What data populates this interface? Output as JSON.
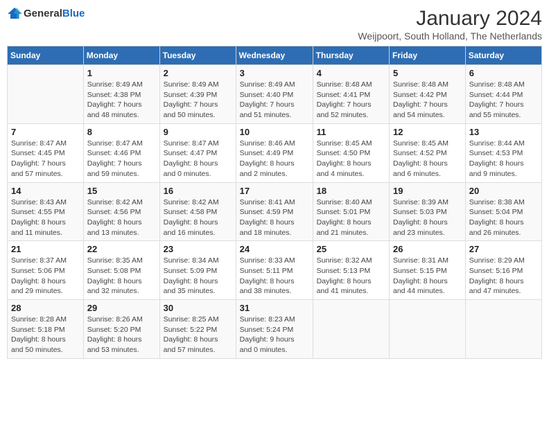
{
  "logo": {
    "text_general": "General",
    "text_blue": "Blue"
  },
  "header": {
    "month_title": "January 2024",
    "subtitle": "Weijpoort, South Holland, The Netherlands"
  },
  "days_of_week": [
    "Sunday",
    "Monday",
    "Tuesday",
    "Wednesday",
    "Thursday",
    "Friday",
    "Saturday"
  ],
  "weeks": [
    {
      "cells": [
        {
          "day": "",
          "info": ""
        },
        {
          "day": "1",
          "info": "Sunrise: 8:49 AM\nSunset: 4:38 PM\nDaylight: 7 hours\nand 48 minutes."
        },
        {
          "day": "2",
          "info": "Sunrise: 8:49 AM\nSunset: 4:39 PM\nDaylight: 7 hours\nand 50 minutes."
        },
        {
          "day": "3",
          "info": "Sunrise: 8:49 AM\nSunset: 4:40 PM\nDaylight: 7 hours\nand 51 minutes."
        },
        {
          "day": "4",
          "info": "Sunrise: 8:48 AM\nSunset: 4:41 PM\nDaylight: 7 hours\nand 52 minutes."
        },
        {
          "day": "5",
          "info": "Sunrise: 8:48 AM\nSunset: 4:42 PM\nDaylight: 7 hours\nand 54 minutes."
        },
        {
          "day": "6",
          "info": "Sunrise: 8:48 AM\nSunset: 4:44 PM\nDaylight: 7 hours\nand 55 minutes."
        }
      ]
    },
    {
      "cells": [
        {
          "day": "7",
          "info": "Sunrise: 8:47 AM\nSunset: 4:45 PM\nDaylight: 7 hours\nand 57 minutes."
        },
        {
          "day": "8",
          "info": "Sunrise: 8:47 AM\nSunset: 4:46 PM\nDaylight: 7 hours\nand 59 minutes."
        },
        {
          "day": "9",
          "info": "Sunrise: 8:47 AM\nSunset: 4:47 PM\nDaylight: 8 hours\nand 0 minutes."
        },
        {
          "day": "10",
          "info": "Sunrise: 8:46 AM\nSunset: 4:49 PM\nDaylight: 8 hours\nand 2 minutes."
        },
        {
          "day": "11",
          "info": "Sunrise: 8:45 AM\nSunset: 4:50 PM\nDaylight: 8 hours\nand 4 minutes."
        },
        {
          "day": "12",
          "info": "Sunrise: 8:45 AM\nSunset: 4:52 PM\nDaylight: 8 hours\nand 6 minutes."
        },
        {
          "day": "13",
          "info": "Sunrise: 8:44 AM\nSunset: 4:53 PM\nDaylight: 8 hours\nand 9 minutes."
        }
      ]
    },
    {
      "cells": [
        {
          "day": "14",
          "info": "Sunrise: 8:43 AM\nSunset: 4:55 PM\nDaylight: 8 hours\nand 11 minutes."
        },
        {
          "day": "15",
          "info": "Sunrise: 8:42 AM\nSunset: 4:56 PM\nDaylight: 8 hours\nand 13 minutes."
        },
        {
          "day": "16",
          "info": "Sunrise: 8:42 AM\nSunset: 4:58 PM\nDaylight: 8 hours\nand 16 minutes."
        },
        {
          "day": "17",
          "info": "Sunrise: 8:41 AM\nSunset: 4:59 PM\nDaylight: 8 hours\nand 18 minutes."
        },
        {
          "day": "18",
          "info": "Sunrise: 8:40 AM\nSunset: 5:01 PM\nDaylight: 8 hours\nand 21 minutes."
        },
        {
          "day": "19",
          "info": "Sunrise: 8:39 AM\nSunset: 5:03 PM\nDaylight: 8 hours\nand 23 minutes."
        },
        {
          "day": "20",
          "info": "Sunrise: 8:38 AM\nSunset: 5:04 PM\nDaylight: 8 hours\nand 26 minutes."
        }
      ]
    },
    {
      "cells": [
        {
          "day": "21",
          "info": "Sunrise: 8:37 AM\nSunset: 5:06 PM\nDaylight: 8 hours\nand 29 minutes."
        },
        {
          "day": "22",
          "info": "Sunrise: 8:35 AM\nSunset: 5:08 PM\nDaylight: 8 hours\nand 32 minutes."
        },
        {
          "day": "23",
          "info": "Sunrise: 8:34 AM\nSunset: 5:09 PM\nDaylight: 8 hours\nand 35 minutes."
        },
        {
          "day": "24",
          "info": "Sunrise: 8:33 AM\nSunset: 5:11 PM\nDaylight: 8 hours\nand 38 minutes."
        },
        {
          "day": "25",
          "info": "Sunrise: 8:32 AM\nSunset: 5:13 PM\nDaylight: 8 hours\nand 41 minutes."
        },
        {
          "day": "26",
          "info": "Sunrise: 8:31 AM\nSunset: 5:15 PM\nDaylight: 8 hours\nand 44 minutes."
        },
        {
          "day": "27",
          "info": "Sunrise: 8:29 AM\nSunset: 5:16 PM\nDaylight: 8 hours\nand 47 minutes."
        }
      ]
    },
    {
      "cells": [
        {
          "day": "28",
          "info": "Sunrise: 8:28 AM\nSunset: 5:18 PM\nDaylight: 8 hours\nand 50 minutes."
        },
        {
          "day": "29",
          "info": "Sunrise: 8:26 AM\nSunset: 5:20 PM\nDaylight: 8 hours\nand 53 minutes."
        },
        {
          "day": "30",
          "info": "Sunrise: 8:25 AM\nSunset: 5:22 PM\nDaylight: 8 hours\nand 57 minutes."
        },
        {
          "day": "31",
          "info": "Sunrise: 8:23 AM\nSunset: 5:24 PM\nDaylight: 9 hours\nand 0 minutes."
        },
        {
          "day": "",
          "info": ""
        },
        {
          "day": "",
          "info": ""
        },
        {
          "day": "",
          "info": ""
        }
      ]
    }
  ]
}
